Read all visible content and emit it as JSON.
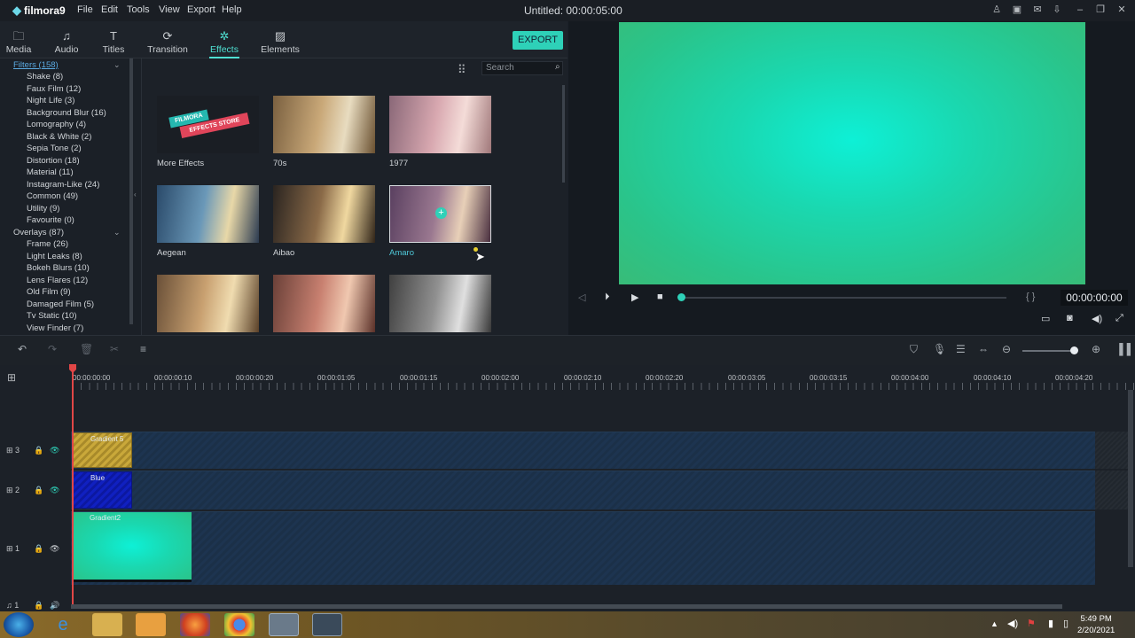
{
  "app": {
    "name": "filmora9",
    "doc_title": "Untitled:  00:00:05:00"
  },
  "menu": [
    "File",
    "Edit",
    "Tools",
    "View",
    "Export",
    "Help"
  ],
  "tabs": [
    {
      "label": "Media",
      "icon": "folder-icon"
    },
    {
      "label": "Audio",
      "icon": "music-note-icon"
    },
    {
      "label": "Titles",
      "icon": "text-icon"
    },
    {
      "label": "Transition",
      "icon": "transition-icon"
    },
    {
      "label": "Effects",
      "icon": "effects-icon",
      "active": true
    },
    {
      "label": "Elements",
      "icon": "image-icon"
    }
  ],
  "export_label": "EXPORT",
  "tree": {
    "filters": {
      "label": "Filters (158)",
      "items": [
        "Shake (8)",
        "Faux Film (12)",
        "Night Life (3)",
        "Background Blur (16)",
        "Lomography (4)",
        "Black & White (2)",
        "Sepia Tone (2)",
        "Distortion (18)",
        "Material (11)",
        "Instagram-Like (24)",
        "Common (49)",
        "Utility (9)",
        "Favourite (0)"
      ]
    },
    "overlays": {
      "label": "Overlays (87)",
      "items": [
        "Frame (26)",
        "Light Leaks (8)",
        "Bokeh Blurs (10)",
        "Lens Flares (12)",
        "Old Film (9)",
        "Damaged Film (5)",
        "Tv Static (10)",
        "View Finder (7)"
      ]
    }
  },
  "search_placeholder": "Search",
  "effects": [
    {
      "label": "More Effects",
      "store_line1": "FILMORA",
      "store_line2": "EFFECTS STORE"
    },
    {
      "label": "70s"
    },
    {
      "label": "1977"
    },
    {
      "label": "Aegean"
    },
    {
      "label": "Aibao"
    },
    {
      "label": "Amaro",
      "hover": true
    },
    {
      "label": ""
    },
    {
      "label": ""
    },
    {
      "label": ""
    }
  ],
  "player": {
    "timecode": "00:00:00:00",
    "braces": "{   }",
    "progress": 0
  },
  "ruler": [
    "00:00:00:00",
    "00:00:00:10",
    "00:00:00:20",
    "00:00:01:05",
    "00:00:01:15",
    "00:00:02:00",
    "00:00:02:10",
    "00:00:02:20",
    "00:00:03:05",
    "00:00:03:15",
    "00:00:04:00",
    "00:00:04:10",
    "00:00:04:20"
  ],
  "tracks": [
    {
      "num": "3",
      "clip": "Gradient 5",
      "color": "#c9a83a"
    },
    {
      "num": "2",
      "clip": "Blue",
      "color": "#1020c0"
    },
    {
      "num": "1",
      "clip": "Gradient2",
      "color": "#1fd8b0"
    }
  ],
  "audio_track_num": "1",
  "clock": {
    "time": "5:49 PM",
    "date": "2/20/2021"
  },
  "colors": {
    "accent": "#2ed1b8",
    "playhead": "#e14646",
    "track_bg": "#1d3450"
  }
}
